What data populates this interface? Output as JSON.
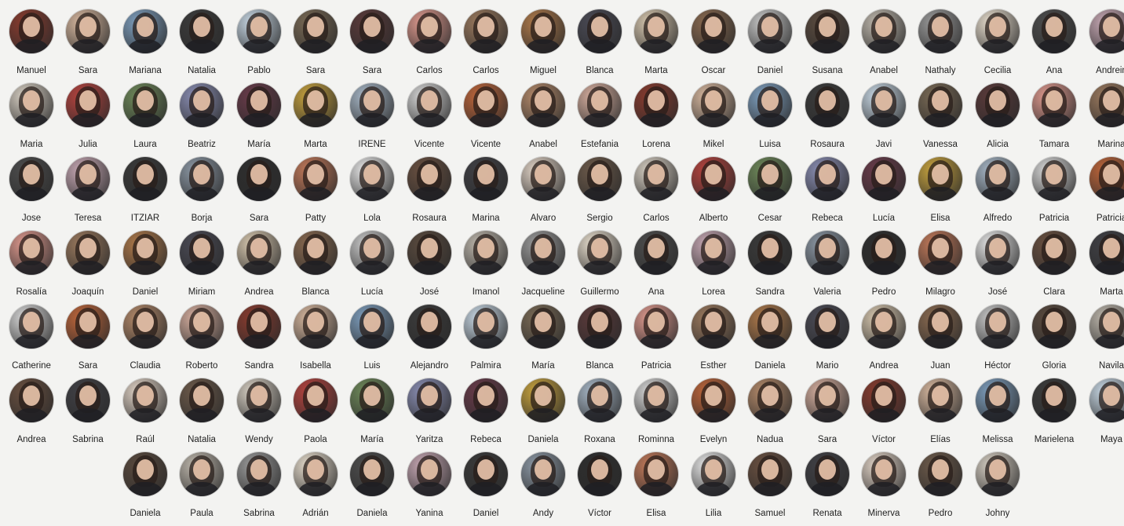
{
  "rows": [
    {
      "names": [
        "Manuel",
        "Sara",
        "Mariana",
        "Natalia",
        "Pablo",
        "Sara",
        "Sara",
        "Carlos",
        "Carlos",
        "Miguel",
        "Blanca",
        "Marta",
        "Óscar",
        "Daniel",
        "Susana",
        "Anabel",
        "Nathaly",
        "Cecilia",
        "Ana",
        "Andrein"
      ]
    },
    {
      "names": [
        "Maria",
        "Julia",
        "Laura",
        "Beatriz",
        "María",
        "Marta",
        "IRENE",
        "Vicente",
        "Vicente",
        "Anabel",
        "Estefania",
        "Lorena",
        "Mikel",
        "Luisa",
        "Rosaura",
        "Javi",
        "Vanessa",
        "Alicia",
        "Tamara",
        "Marina"
      ]
    },
    {
      "names": [
        "Jose",
        "Teresa",
        "ITZÍAR",
        "Borja",
        "Sara",
        "Patty",
        "Lola",
        "Rosaura",
        "Marina",
        "Álvaro",
        "Sergio",
        "Carlos",
        "Alberto",
        "Cesar",
        "Rebeca",
        "Lucía",
        "Elisa",
        "Alfredo",
        "Patricia",
        "Patricia"
      ]
    },
    {
      "names": [
        "Rosalía",
        "Joaquín",
        "Daniel",
        "Miriam",
        "Andrea",
        "Blanca",
        "Lucía",
        "José",
        "Imanol",
        "Jacqueline",
        "Guillermo",
        "Ana",
        "Lorea",
        "Sandra",
        "Valeria",
        "Pedro",
        "Milagro",
        "José",
        "Clara",
        "Marta"
      ]
    },
    {
      "names": [
        "Catherine",
        "Sara",
        "Claudia",
        "Roberto",
        "Sandra",
        "Isabella",
        "Luis",
        "Alejandro",
        "Palmira",
        "María",
        "Blanca",
        "Patricia",
        "Esther",
        "Daniela",
        "Mario",
        "Andrea",
        "Juan",
        "Héctor",
        "Gloria",
        "Navila"
      ]
    },
    {
      "names": [
        "Andrea",
        "Sabrina",
        "Raúl",
        "Natalia",
        "Wendy",
        "Paola",
        "María",
        "Yaritza",
        "Rebeca",
        "Daniela",
        "Roxana",
        "Rominna",
        "Evelyn",
        "Nadua",
        "Sara",
        "Víctor",
        "Elías",
        "Melissa",
        "Marielena",
        "Maya"
      ]
    },
    {
      "names": [
        "Daniela",
        "Paula",
        "Sabrina",
        "Adrián",
        "Daniela",
        "Yanina",
        "Daniel",
        "Andy",
        "Víctor",
        "Elisa",
        "Lilia",
        "Samuel",
        "Renata",
        "Minerva",
        "Pedro",
        "Johny"
      ]
    }
  ],
  "colors": [
    "#8a3b2e",
    "#e3d5c8",
    "#5a4a3e",
    "#d9b9a0",
    "#6d5a4a",
    "#bfb8ad",
    "#7fa0c0",
    "#d8d0c4",
    "#9a9a9a",
    "#3b3b3b",
    "#b8433e",
    "#e9dfcf",
    "#c9d9e6",
    "#6f8a5a",
    "#4d4d4d",
    "#7a6a55",
    "#8b8fb5",
    "#c8a9b5",
    "#5b3a3a",
    "#6a3b4a",
    "#3a3a3a",
    "#e09a8f",
    "#c9a43e",
    "#8d99a6",
    "#9c7a5e",
    "#a9b9c9",
    "#2e2e2e",
    "#b07a4a",
    "#d8d8d8",
    "#c47a5a",
    "#4a4a55",
    "#c0663a",
    "#e8e8e8",
    "#d9c9b0",
    "#b58a6a",
    "#6a5040",
    "#8a6a50",
    "#d8b0a0",
    "#404045",
    "#c9c9c9"
  ]
}
